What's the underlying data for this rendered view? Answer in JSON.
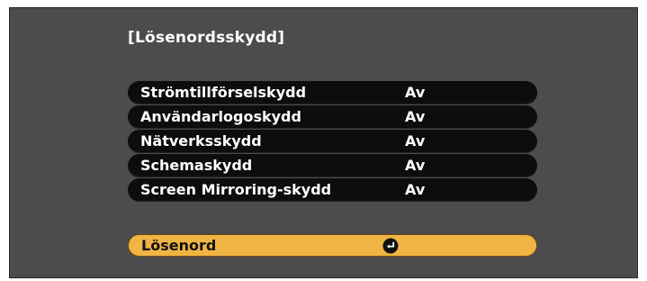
{
  "screen": {
    "title": "[Lösenordsskydd]"
  },
  "menu": {
    "items": [
      {
        "label": "Strömtillförselskydd",
        "value": "Av"
      },
      {
        "label": "Användarlogoskydd",
        "value": "Av"
      },
      {
        "label": "Nätverksskydd",
        "value": "Av"
      },
      {
        "label": "Schemaskydd",
        "value": "Av"
      },
      {
        "label": "Screen Mirroring-skydd",
        "value": "Av"
      }
    ]
  },
  "password": {
    "label": "Lösenord",
    "icon": "enter-icon"
  },
  "colors": {
    "background": "#4c4c4c",
    "row": "#0d0d0d",
    "highlight": "#f0b544",
    "text": "#ffffff"
  }
}
